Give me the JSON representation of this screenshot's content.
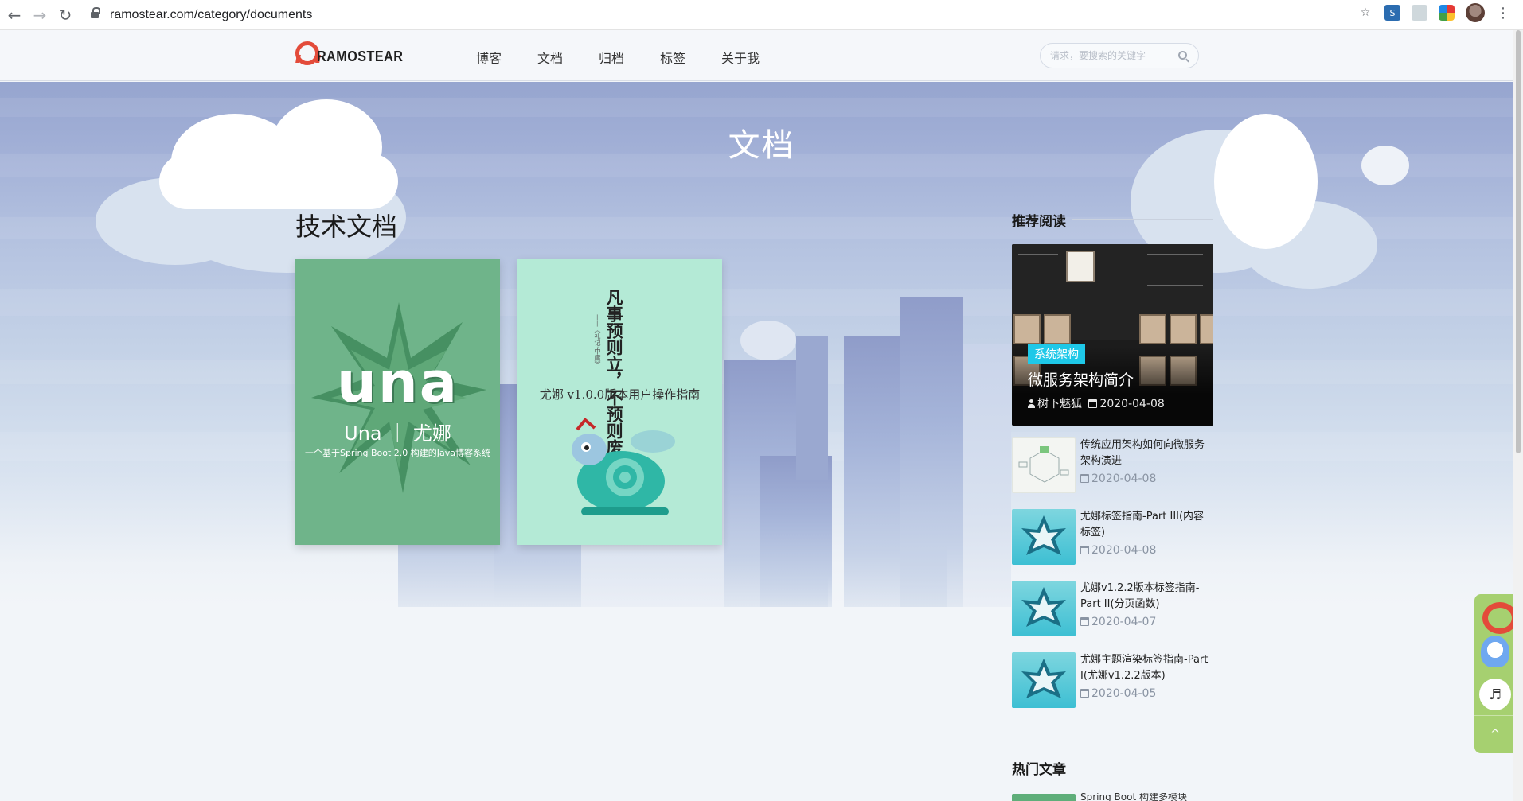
{
  "browser": {
    "url": "ramostear.com/category/documents"
  },
  "site": {
    "logo_text": "RAMOSTEAR",
    "nav": [
      "博客",
      "文档",
      "归档",
      "标签",
      "关于我"
    ],
    "search_placeholder": "请求，要搜索的关键字"
  },
  "page": {
    "title": "文档",
    "section_heading": "技术文档"
  },
  "docs": [
    {
      "big_word": "una",
      "subtitle": "Una ｜ 尤娜",
      "description": "一个基于Spring Boot 2.0 构建的Java博客系统"
    },
    {
      "poem": "凡事预则立，不预则废。",
      "poem_source": "——《礼记·中庸》",
      "title": "尤娜 v1.0.0版本用户操作指南"
    }
  ],
  "sidebar": {
    "recommended_title": "推荐阅读",
    "hot_title": "热门文章",
    "featured": {
      "tag": "系统架构",
      "title": "微服务架构简介",
      "author": "树下魅狐",
      "date": "2020-04-08"
    },
    "items": [
      {
        "title": "传统应用架构如何向微服务架构演进",
        "date": "2020-04-08",
        "thumb": "diagram"
      },
      {
        "title": "尤娜标签指南-Part III(内容标签)",
        "date": "2020-04-08",
        "thumb": "star"
      },
      {
        "title": "尤娜v1.2.2版本标签指南-Part II(分页函数)",
        "date": "2020-04-07",
        "thumb": "star"
      },
      {
        "title": "尤娜主题渲染标签指南-Part I(尤娜v1.2.2版本)",
        "date": "2020-04-05",
        "thumb": "star"
      }
    ],
    "hot_first_title": "Spring Boot 构建多模块"
  },
  "widget": {
    "top_label": "^",
    "music_icon": "♬"
  },
  "colors": {
    "accent_tag": "#1ec8e8",
    "logo_red": "#e34b3a",
    "widget_green": "#a6d070",
    "card_green": "#6fb48a",
    "card_mint": "#b4ead6"
  }
}
